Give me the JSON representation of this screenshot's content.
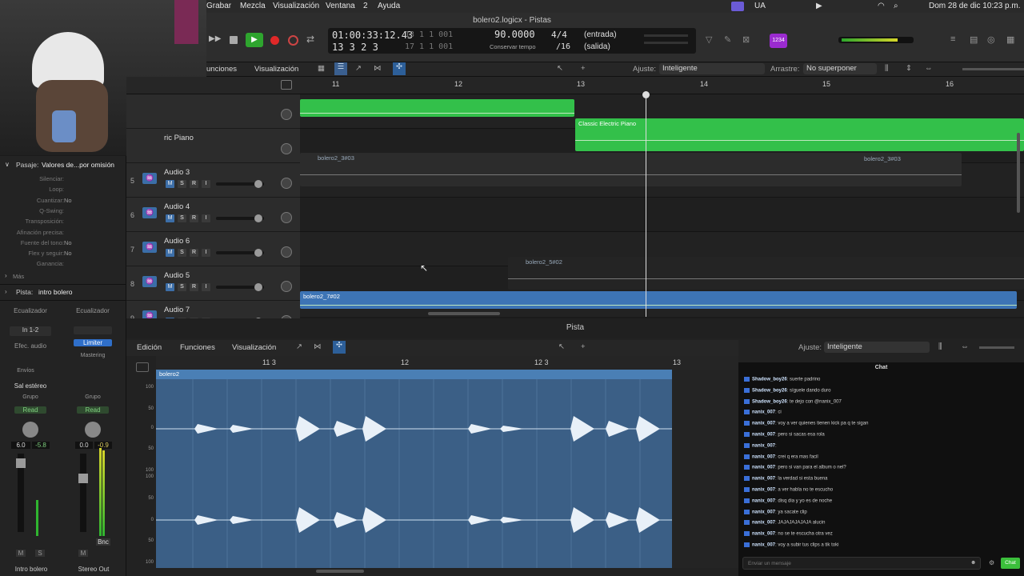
{
  "menubar": {
    "items": [
      "Grabar",
      "Mezcla",
      "Visualización",
      "Ventana",
      "2",
      "Ayuda"
    ],
    "status": [
      "UA"
    ],
    "datetime": "Dom 28 de dic 10:23 p.m."
  },
  "window": {
    "title": "bolero2.logicx - Pistas"
  },
  "lcd": {
    "time": "01:00:33:12.43",
    "bars": "13  1  1  001",
    "bars2": "13  3  2  3",
    "bars3": "17  1  1  001",
    "tempo": "90.0000",
    "tempo_label": "Conservar tempo",
    "sig": "4/4",
    "div": "/16",
    "in": "(entrada)",
    "out": "(salida)"
  },
  "toolbar": {
    "funciones": "unciones",
    "visualizacion": "Visualización",
    "ajuste_label": "Ajuste:",
    "ajuste_value": "Inteligente",
    "arrastre_label": "Arrastre:",
    "arrastre_value": "No superponer",
    "badge": "1234"
  },
  "inspector": {
    "pasaje_label": "Pasaje:",
    "pasaje_value": "Valores de...por omisión",
    "props": [
      [
        "Silenciar:",
        ""
      ],
      [
        "Loop:",
        ""
      ],
      [
        "Cuantizar:",
        "No"
      ],
      [
        "Q-Swing:",
        ""
      ],
      [
        "Transposición:",
        ""
      ],
      [
        "Afinación precisa:",
        ""
      ],
      [
        "Fuente del tono:",
        "No"
      ],
      [
        "Flex y seguir:",
        "No"
      ],
      [
        "Ganancia:",
        ""
      ]
    ],
    "mas": "Más",
    "pista_label": "Pista:",
    "pista_value": "intro bolero",
    "ch1": {
      "eq": "Ecualizador",
      "input": "In 1-2",
      "efec": "Efec. audio",
      "envios": "Envíos",
      "out": "Sal estéreo",
      "group": "Grupo",
      "auto": "Read",
      "vol": "6.0",
      "peak": "-5.8",
      "name": "Intro bolero",
      "m": "M",
      "s": "S"
    },
    "ch2": {
      "eq": "Ecualizador",
      "plugin": "Limiter",
      "mastering": "Mastering",
      "group": "Grupo",
      "auto": "Read",
      "vol": "0.0",
      "peak": "-0.9",
      "bnc": "Bnc",
      "name": "Stereo Out",
      "m": "M"
    }
  },
  "tracks": [
    {
      "num": "",
      "name": "",
      "partial": true
    },
    {
      "num": "",
      "name": "ric Piano"
    },
    {
      "num": "5",
      "name": "Audio 3"
    },
    {
      "num": "6",
      "name": "Audio 4"
    },
    {
      "num": "7",
      "name": "Audio 6"
    },
    {
      "num": "8",
      "name": "Audio 5"
    },
    {
      "num": "9",
      "name": "Audio 7"
    }
  ],
  "track_buttons": [
    "M",
    "S",
    "R",
    "I"
  ],
  "ruler": [
    "11",
    "12",
    "13",
    "14",
    "15",
    "16"
  ],
  "regions": {
    "piano": "Classic Electric Piano",
    "r1": "bolero2_3#03",
    "r2": "bolero2_3#03",
    "r3": "bolero2_5#02",
    "r4": "bolero2_7#02"
  },
  "pista_title": "Pista",
  "editor": {
    "edicion": "Edición",
    "funciones": "Funciones",
    "visualizacion": "Visualización",
    "ajuste_label": "Ajuste:",
    "ajuste_value": "Inteligente",
    "ruler": [
      "11 3",
      "12",
      "12 3",
      "13"
    ],
    "region": "bolero2",
    "scale": [
      "100",
      "50",
      "0",
      "50",
      "100",
      "100",
      "50",
      "0",
      "50",
      "100"
    ]
  },
  "chat": {
    "title": "Chat",
    "placeholder": "Enviar un mensaje",
    "send": "Chat",
    "messages": [
      {
        "user": "Shadow_boy26",
        "text": "suerte padrino"
      },
      {
        "user": "Shadow_boy26",
        "text": "síguele dando duro"
      },
      {
        "user": "Shadow_boy26",
        "text": "te dejo con @nanix_007"
      },
      {
        "user": "nanix_007",
        "text": "ci"
      },
      {
        "user": "nanix_007",
        "text": "voy a ver quienes tienen kick pa q te sigan"
      },
      {
        "user": "nanix_007",
        "text": "pero si sacas esa rola"
      },
      {
        "user": "nanix_007",
        "text": ""
      },
      {
        "user": "nanix_007",
        "text": "crei q era mas facil"
      },
      {
        "user": "nanix_007",
        "text": "pero si van para el album o nel?"
      },
      {
        "user": "nanix_007",
        "text": "la verdad si esta buena"
      },
      {
        "user": "nanix_007",
        "text": "a ver habla no te escucho"
      },
      {
        "user": "nanix_007",
        "text": "disq dia y yo es de noche"
      },
      {
        "user": "nanix_007",
        "text": "ya sacate clip"
      },
      {
        "user": "nanix_007",
        "text": "JAJAJAJAJAJA alucin"
      },
      {
        "user": "nanix_007",
        "text": "no se te escucha otra vez"
      },
      {
        "user": "nanix_007",
        "text": "voy a subir tus clips a tik toki"
      }
    ]
  }
}
